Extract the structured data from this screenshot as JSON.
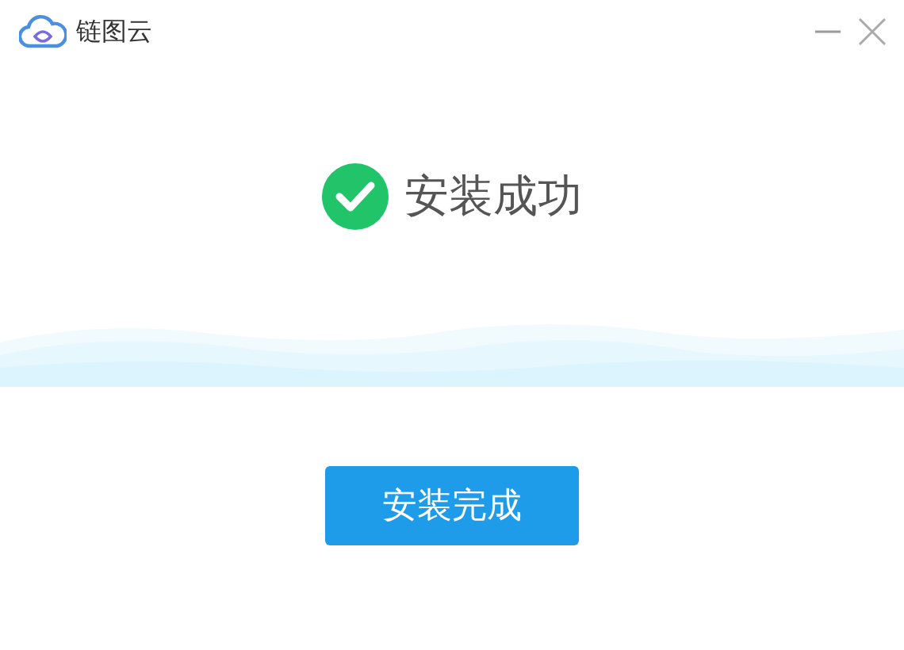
{
  "window": {
    "title": "链图云"
  },
  "status": {
    "kind": "success",
    "message": "安装成功"
  },
  "buttons": [
    "安装完成"
  ]
}
